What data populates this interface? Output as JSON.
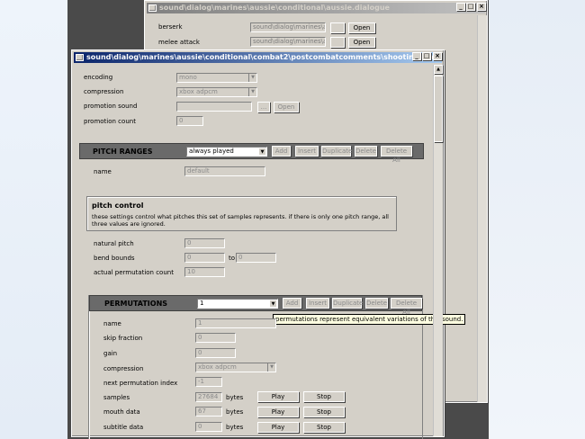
{
  "back_window": {
    "title": "sound\\dialog\\marines\\aussie\\conditional\\aussie.dialogue",
    "rows": [
      {
        "label": "berserk",
        "value": "sound\\dialog\\marines\\aus",
        "button": "Open"
      },
      {
        "label": "melee attack",
        "value": "sound\\dialog\\marines\\aus",
        "button": "Open"
      }
    ]
  },
  "front_window": {
    "title": "sound\\dialog\\marines\\aussie\\conditional\\combat2\\postcombatcomments\\shootingdeadenemypla...",
    "min_btn": "_",
    "max_btn": "□",
    "close_btn": "×",
    "encoding": {
      "label": "encoding",
      "value": "mono"
    },
    "compression": {
      "label": "compression",
      "value": "xbox adpcm"
    },
    "promotion_sound": {
      "label": "promotion sound",
      "value": "",
      "browse": "...",
      "open": "Open"
    },
    "promotion_count": {
      "label": "promotion count",
      "value": "0"
    },
    "pitch_ranges": {
      "title": "PITCH RANGES",
      "dropdown": "always played",
      "buttons": [
        "Add",
        "Insert",
        "Duplicate",
        "Delete",
        "Delete All"
      ],
      "name_label": "name",
      "name_value": "default",
      "pitch_control_title": "pitch control",
      "pitch_control_desc": "these settings control what pitches this set of samples represents. if there is only one pitch range, all three values are ignored.",
      "natural_pitch_label": "natural pitch",
      "natural_pitch_value": "0",
      "bend_bounds_label": "bend bounds",
      "bend_from": "0",
      "bend_to_label": "to",
      "bend_to": "0",
      "actual_perm_label": "actual permutation count",
      "actual_perm_value": "10"
    },
    "permutations": {
      "title": "PERMUTATIONS",
      "dropdown": "1",
      "buttons": [
        "Add",
        "Insert",
        "Duplicate",
        "Delete",
        "Delete All"
      ],
      "tooltip": "permutations represent equivalent variations of this sound.",
      "name_label": "name",
      "name_value": "1",
      "skip_fraction_label": "skip fraction",
      "skip_fraction_value": "0",
      "gain_label": "gain",
      "gain_value": "0",
      "compression_label": "compression",
      "compression_value": "xbox adpcm",
      "next_perm_label": "next permutation index",
      "next_perm_value": "-1",
      "samples": {
        "label": "samples",
        "value": "27684",
        "unit": "bytes",
        "play": "Play",
        "stop": "Stop"
      },
      "mouth_data": {
        "label": "mouth data",
        "value": "67",
        "unit": "bytes",
        "play": "Play",
        "stop": "Stop"
      },
      "subtitle_data": {
        "label": "subtitle data",
        "value": "0",
        "unit": "bytes",
        "play": "Play",
        "stop": "Stop"
      }
    }
  }
}
